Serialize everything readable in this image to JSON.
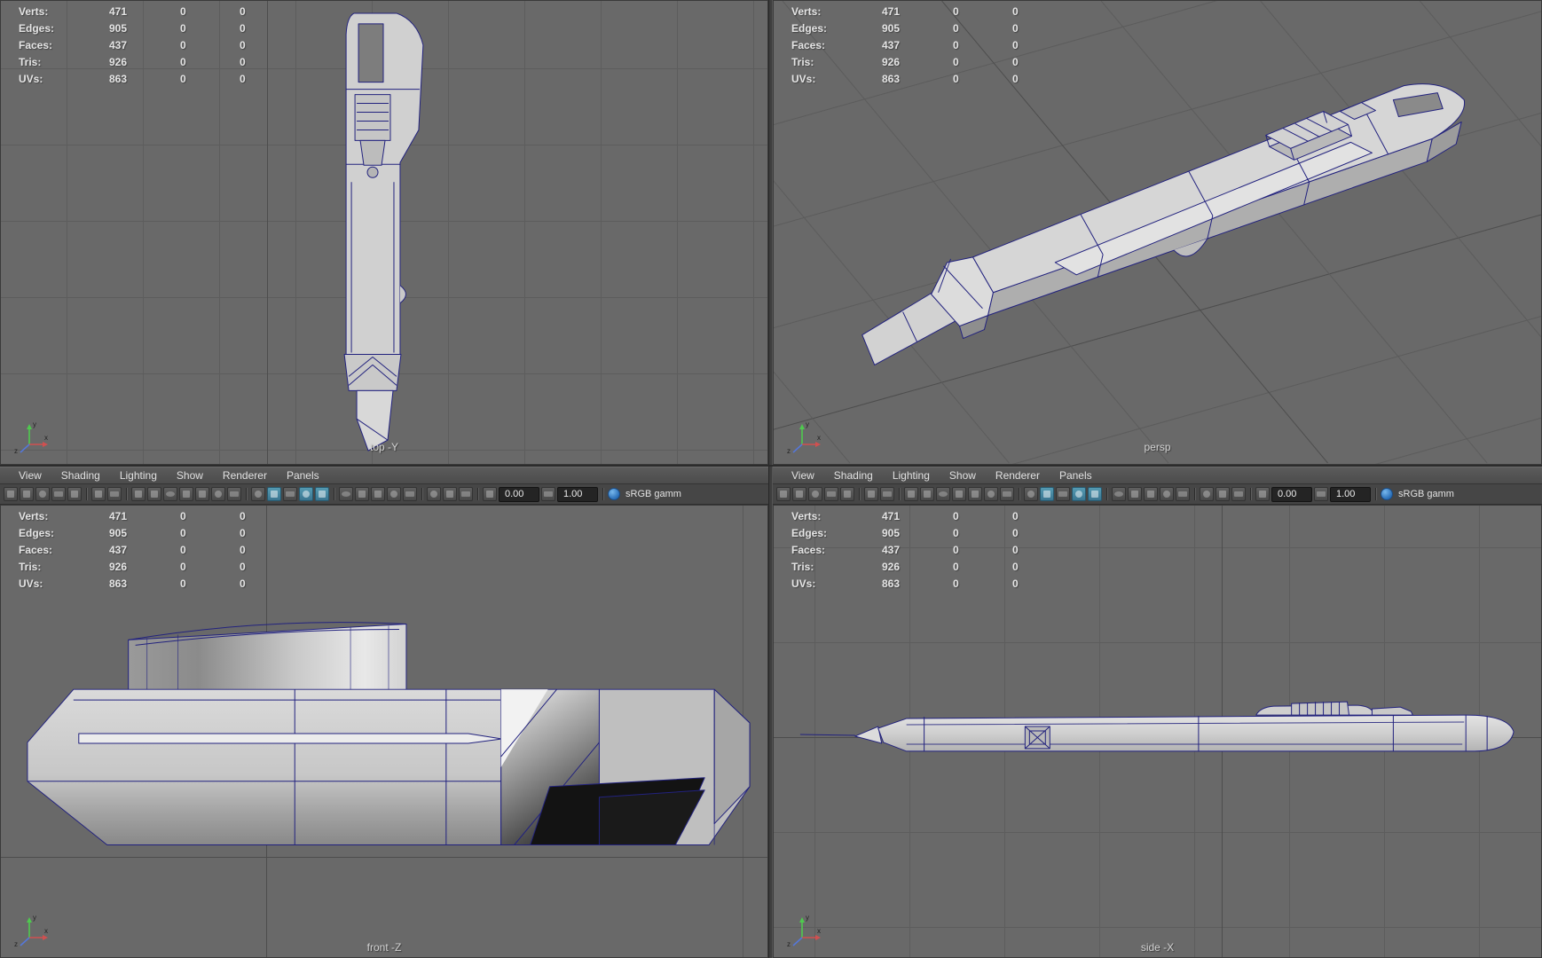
{
  "colors": {
    "viewport_bg": "#696969",
    "grid_line": "#5d5d5d",
    "grid_axis_line": "#4d4d4d",
    "wireframe": "#22227e",
    "hud_text": "#e4e4e4",
    "menu_bg": "#4c4c4c",
    "toolbar_bg": "#464646",
    "active_icon": "#3a7590",
    "colorspace_icon_blue": "#2a6fb8"
  },
  "hud": {
    "rows": [
      {
        "label": "Verts:",
        "v1": "471",
        "v2": "0",
        "v3": "0"
      },
      {
        "label": "Edges:",
        "v1": "905",
        "v2": "0",
        "v3": "0"
      },
      {
        "label": "Faces:",
        "v1": "437",
        "v2": "0",
        "v3": "0"
      },
      {
        "label": "Tris:",
        "v1": "926",
        "v2": "0",
        "v3": "0"
      },
      {
        "label": "UVs:",
        "v1": "863",
        "v2": "0",
        "v3": "0"
      }
    ]
  },
  "viewports": {
    "top": {
      "label": "top -Y"
    },
    "persp": {
      "label": "persp"
    },
    "front": {
      "label": "front -Z"
    },
    "side": {
      "label": "side -X"
    }
  },
  "panel_menu": {
    "items": [
      "View",
      "Shading",
      "Lighting",
      "Show",
      "Renderer",
      "Panels"
    ]
  },
  "toolbar": {
    "exposure_value": "0.00",
    "gamma_value": "1.00",
    "colorspace_label": "sRGB gamm",
    "icons": [
      {
        "name": "select-camera-icon"
      },
      {
        "name": "lock-camera-icon"
      },
      {
        "name": "camera-attributes-icon"
      },
      {
        "name": "bookmarks-icon"
      },
      {
        "name": "image-plane-icon"
      },
      {
        "sep": true
      },
      {
        "name": "two-d-pan-zoom-icon"
      },
      {
        "name": "grease-pencil-icon"
      },
      {
        "sep": true
      },
      {
        "name": "grid-toggle-icon"
      },
      {
        "name": "film-gate-icon"
      },
      {
        "name": "resolution-gate-icon"
      },
      {
        "name": "gate-mask-icon"
      },
      {
        "name": "field-chart-icon"
      },
      {
        "name": "safe-action-icon"
      },
      {
        "name": "safe-title-icon"
      },
      {
        "sep": true
      },
      {
        "name": "wireframe-mode-icon"
      },
      {
        "name": "smooth-shade-icon",
        "active": true
      },
      {
        "name": "wireframe-on-shaded-icon"
      },
      {
        "name": "textured-mode-icon",
        "active": true
      },
      {
        "name": "use-default-material-icon",
        "active": true
      },
      {
        "sep": true
      },
      {
        "name": "default-lighting-icon"
      },
      {
        "name": "all-lights-icon"
      },
      {
        "name": "shadows-icon"
      },
      {
        "name": "screen-space-ao-icon"
      },
      {
        "name": "motion-blur-icon"
      },
      {
        "sep": true
      },
      {
        "name": "isolate-select-icon"
      },
      {
        "name": "xray-icon"
      },
      {
        "name": "xray-joints-icon"
      },
      {
        "sep": true
      }
    ]
  },
  "axis": {
    "x": "x",
    "y": "y",
    "z": "z"
  }
}
